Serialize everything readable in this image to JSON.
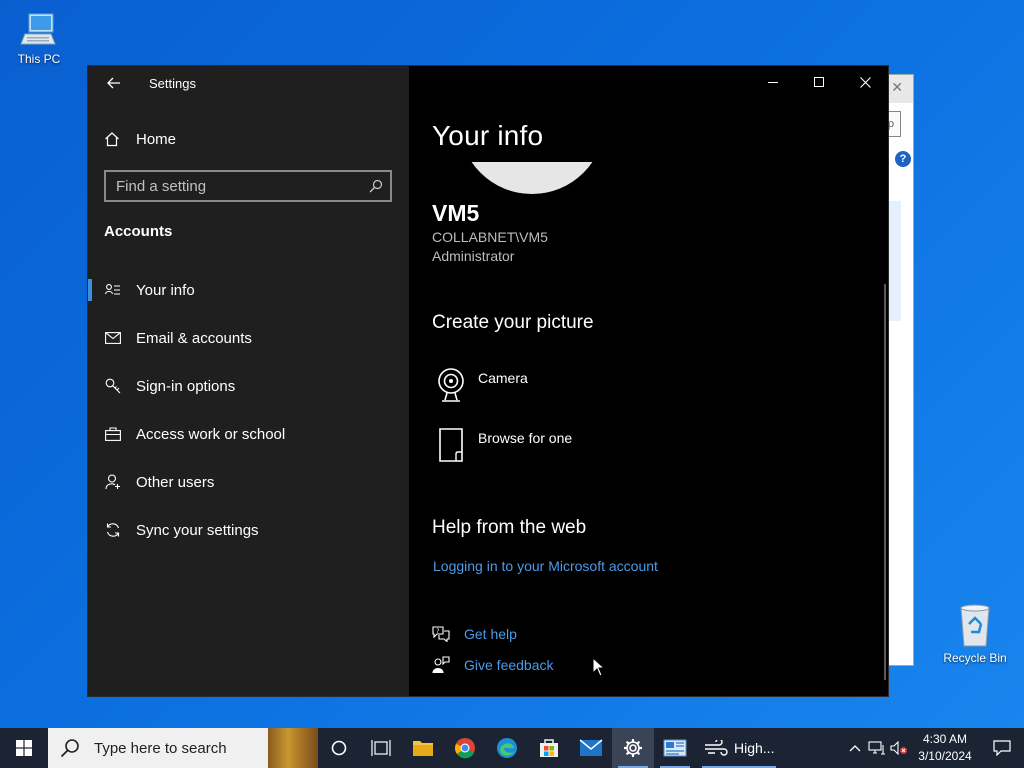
{
  "desktop": {
    "this_pc_label": "This PC",
    "recycle_bin_label": "Recycle Bin"
  },
  "settings": {
    "app_title": "Settings",
    "home_label": "Home",
    "search_placeholder": "Find a setting",
    "section_label": "Accounts",
    "nav_items": [
      {
        "label": "Your info",
        "icon": "user-card-icon",
        "active": true
      },
      {
        "label": "Email & accounts",
        "icon": "mail-icon",
        "active": false
      },
      {
        "label": "Sign-in options",
        "icon": "key-icon",
        "active": false
      },
      {
        "label": "Access work or school",
        "icon": "briefcase-icon",
        "active": false
      },
      {
        "label": "Other users",
        "icon": "person-add-icon",
        "active": false
      },
      {
        "label": "Sync your settings",
        "icon": "sync-icon",
        "active": false
      }
    ],
    "main": {
      "title": "Your info",
      "user_name": "VM5",
      "user_domain": "COLLABNET\\VM5",
      "user_role": "Administrator",
      "create_picture_heading": "Create your picture",
      "camera_label": "Camera",
      "browse_label": "Browse for one",
      "help_heading": "Help from the web",
      "help_link": "Logging in to your Microsoft account",
      "get_help_label": "Get help",
      "give_feedback_label": "Give feedback"
    }
  },
  "taskbar": {
    "search_placeholder": "Type here to search",
    "weather_label": "High...",
    "time": "4:30 AM",
    "date": "3/10/2024"
  },
  "colors": {
    "accent": "#3a8fe3",
    "link": "#4a9be8",
    "sidebar_bg": "#1f1f1f",
    "main_bg": "#000000",
    "taskbar_bg": "#1c2433"
  }
}
